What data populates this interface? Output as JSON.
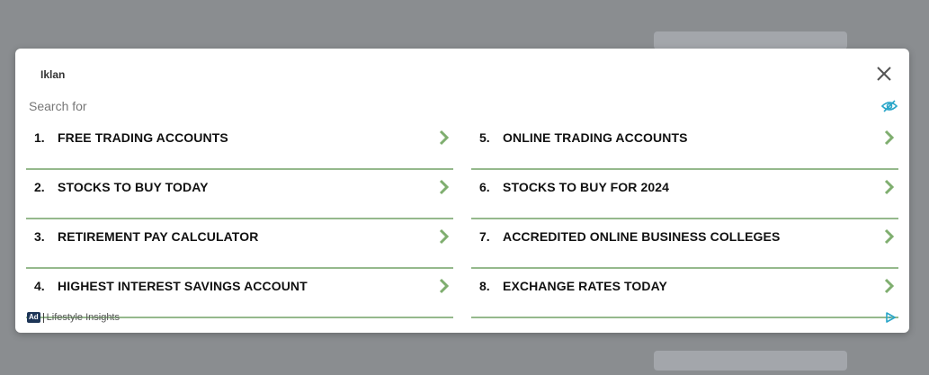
{
  "modal": {
    "title": "Iklan",
    "search_label": "Search for",
    "left_items": [
      {
        "num": "1.",
        "text": "FREE TRADING ACCOUNTS"
      },
      {
        "num": "2.",
        "text": "STOCKS TO BUY TODAY"
      },
      {
        "num": "3.",
        "text": "RETIREMENT PAY CALCULATOR"
      },
      {
        "num": "4.",
        "text": "HIGHEST INTEREST SAVINGS ACCOUNT"
      }
    ],
    "right_items": [
      {
        "num": "5.",
        "text": "ONLINE TRADING ACCOUNTS"
      },
      {
        "num": "6.",
        "text": "STOCKS TO BUY FOR 2024"
      },
      {
        "num": "7.",
        "text": "ACCREDITED ONLINE BUSINESS COLLEGES"
      },
      {
        "num": "8.",
        "text": "EXCHANGE RATES TODAY"
      }
    ],
    "footer": {
      "ad_badge": "Ad",
      "source": "Lifestyle Insights"
    }
  },
  "icons": {
    "close": "close-icon",
    "eye": "eye-slash-icon",
    "chevron": "chevron-right-icon",
    "adchoices": "adchoices-icon"
  },
  "colors": {
    "overlay": "#8a8d90",
    "divider": "#95b98c",
    "chevron": "#7fae6f",
    "accent_blue": "#2aa6c9",
    "ad_badge": "#1d3557"
  }
}
